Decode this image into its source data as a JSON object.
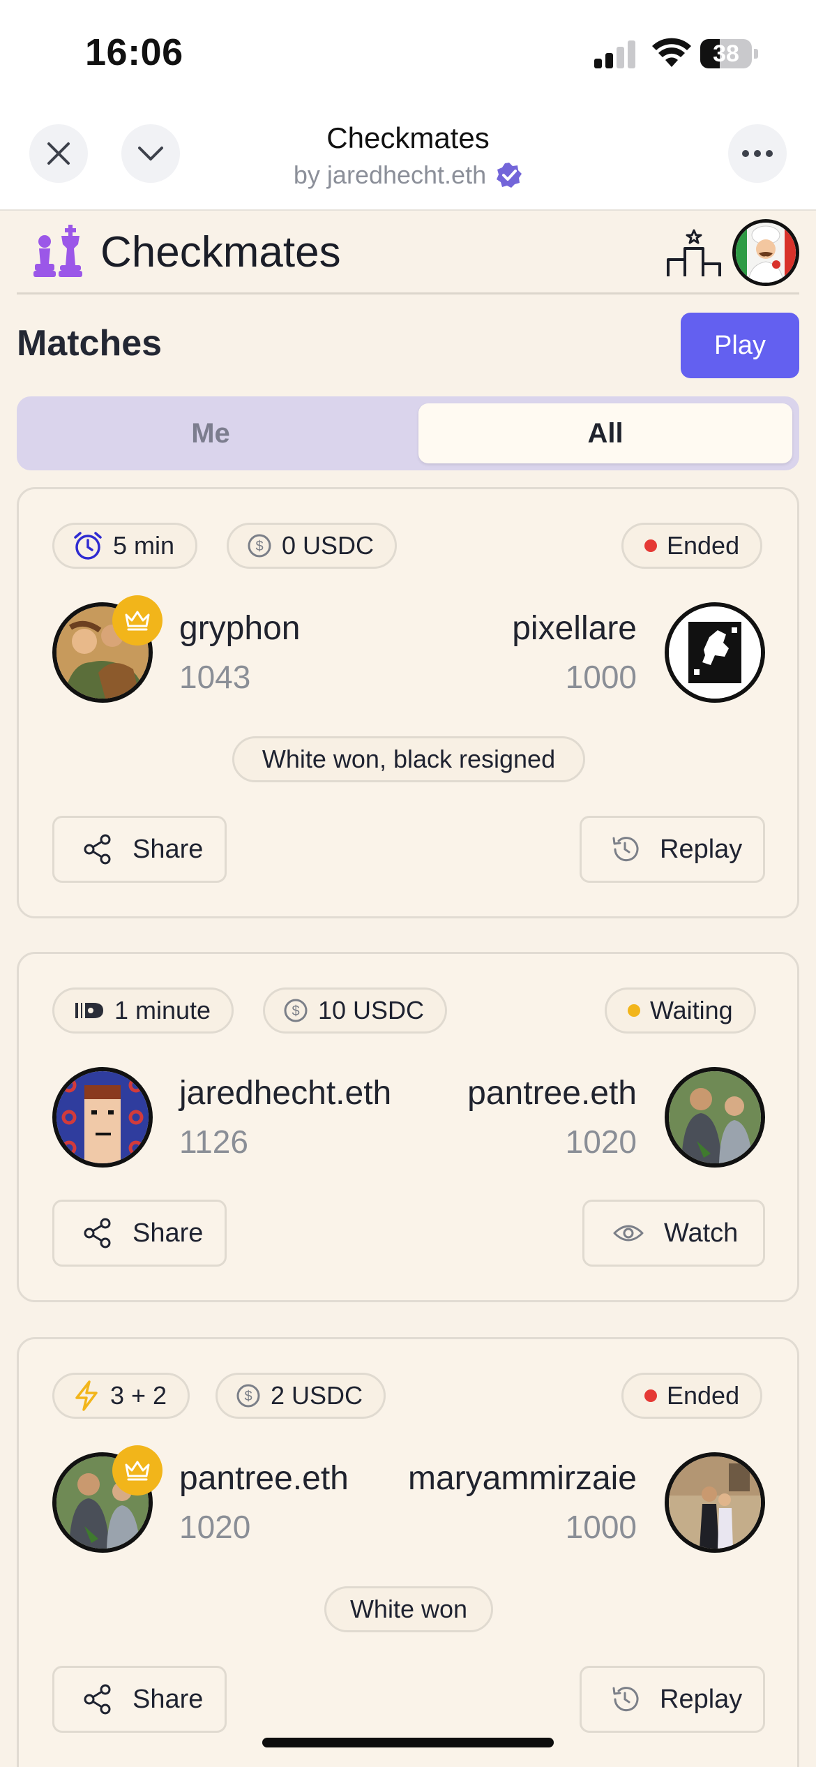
{
  "status_bar": {
    "time": "16:06",
    "battery": "38"
  },
  "host": {
    "title": "Checkmates",
    "by_line": "by jaredhecht.eth"
  },
  "app": {
    "title": "Checkmates"
  },
  "matches": {
    "title": "Matches",
    "play_label": "Play",
    "filters": {
      "me": "Me",
      "all": "All",
      "selected": "All"
    },
    "cards": [
      {
        "time_control": "5 min",
        "stake": "0 USDC",
        "status": "Ended",
        "status_color": "#e53935",
        "white": {
          "name": "gryphon",
          "rating": "1043",
          "crowned": true
        },
        "black": {
          "name": "pixellare",
          "rating": "1000"
        },
        "result": "White won, black resigned",
        "share_label": "Share",
        "action_label": "Replay"
      },
      {
        "time_control": "1 minute",
        "stake": "10 USDC",
        "status": "Waiting",
        "status_color": "#f2b51a",
        "white": {
          "name": "jaredhecht.eth",
          "rating": "1126"
        },
        "black": {
          "name": "pantree.eth",
          "rating": "1020"
        },
        "share_label": "Share",
        "action_label": "Watch"
      },
      {
        "time_control": "3 + 2",
        "stake": "2 USDC",
        "status": "Ended",
        "status_color": "#e53935",
        "white": {
          "name": "pantree.eth",
          "rating": "1020",
          "crowned": true
        },
        "black": {
          "name": "maryammirzaie",
          "rating": "1000"
        },
        "result": "White won",
        "share_label": "Share",
        "action_label": "Replay"
      }
    ]
  },
  "colors": {
    "accent": "#6360f0",
    "crown": "#f2b51a",
    "ended": "#e53935",
    "waiting": "#f2b51a"
  }
}
